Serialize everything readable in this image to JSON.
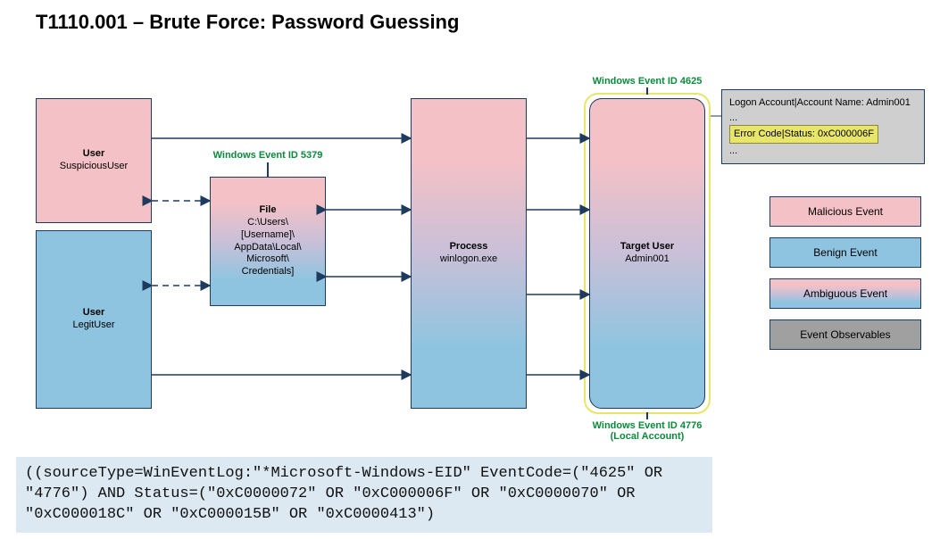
{
  "title": "T1110.001 – Brute Force: Password Guessing",
  "nodes": {
    "suspicious_user": {
      "label": "User",
      "sub": "SuspiciousUser"
    },
    "legit_user": {
      "label": "User",
      "sub": "LegitUser"
    },
    "file": {
      "label": "File",
      "sub": "C:\\Users\\\n[Username]\\\nAppData\\Local\\\nMicrosoft\\\nCredentials]"
    },
    "process": {
      "label": "Process",
      "sub": "winlogon.exe"
    },
    "target_user": {
      "label": "Target User",
      "sub": "Admin001"
    }
  },
  "event_labels": {
    "file": "Windows Event ID 5379",
    "target_top": "Windows Event ID 4625",
    "target_bottom": "Windows Event ID 4776\n(Local Account)"
  },
  "observables": {
    "line1": "Logon Account|Account Name: Admin001",
    "ellipsis1": "...",
    "highlight_key": "Error Code|Status",
    "highlight_val": ": 0xC000006F",
    "ellipsis2": "..."
  },
  "legend": {
    "malicious": "Malicious Event",
    "benign": "Benign Event",
    "ambiguous": "Ambiguous Event",
    "observables": "Event Observables"
  },
  "query": "((sourceType=WinEventLog:\"*Microsoft-Windows-EID\" EventCode=(\"4625\" OR \"4776\") AND Status=(\"0xC0000072\" OR \"0xC000006F\" OR \"0xC0000070\" OR \"0xC000018C\" OR \"0xC000015B\" OR \"0xC0000413\")"
}
